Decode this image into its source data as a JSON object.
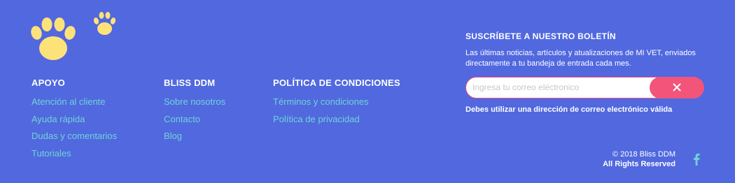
{
  "brand": {
    "paw_color": "#fde27a",
    "icon": "paw-icon"
  },
  "columns": [
    {
      "title": "APOYO",
      "links": [
        "Atención al cliente",
        "Ayuda rápida",
        "Dudas y comentarios",
        "Tutoriales"
      ]
    },
    {
      "title": "BLISS DDM",
      "links": [
        "Sobre nosotros",
        "Contacto",
        "Blog"
      ]
    },
    {
      "title": "POLÍTICA DE CONDICIONES",
      "links": [
        "Términos y condiciones",
        "Política de privacidad"
      ]
    }
  ],
  "newsletter": {
    "title": "SUSCRÍBETE A NUESTRO BOLETÍN",
    "description": "Las últimas noticias, artículos y atualizaciones de MI VET, enviados directamente a tu bandeja de entrada cada mes.",
    "email_value": "",
    "placeholder": "Ingresa tu correo eléctronico",
    "button_icon": "close-icon",
    "error": "Debes utilizar una dirección de correo electrónico válida"
  },
  "footer": {
    "copyright": "© 2018 Bliss DDM",
    "rights": "All Rights Reserved",
    "social_icon": "facebook-icon"
  },
  "colors": {
    "background": "#5168df",
    "link": "#6fd3d6",
    "accent": "#f2547a"
  }
}
